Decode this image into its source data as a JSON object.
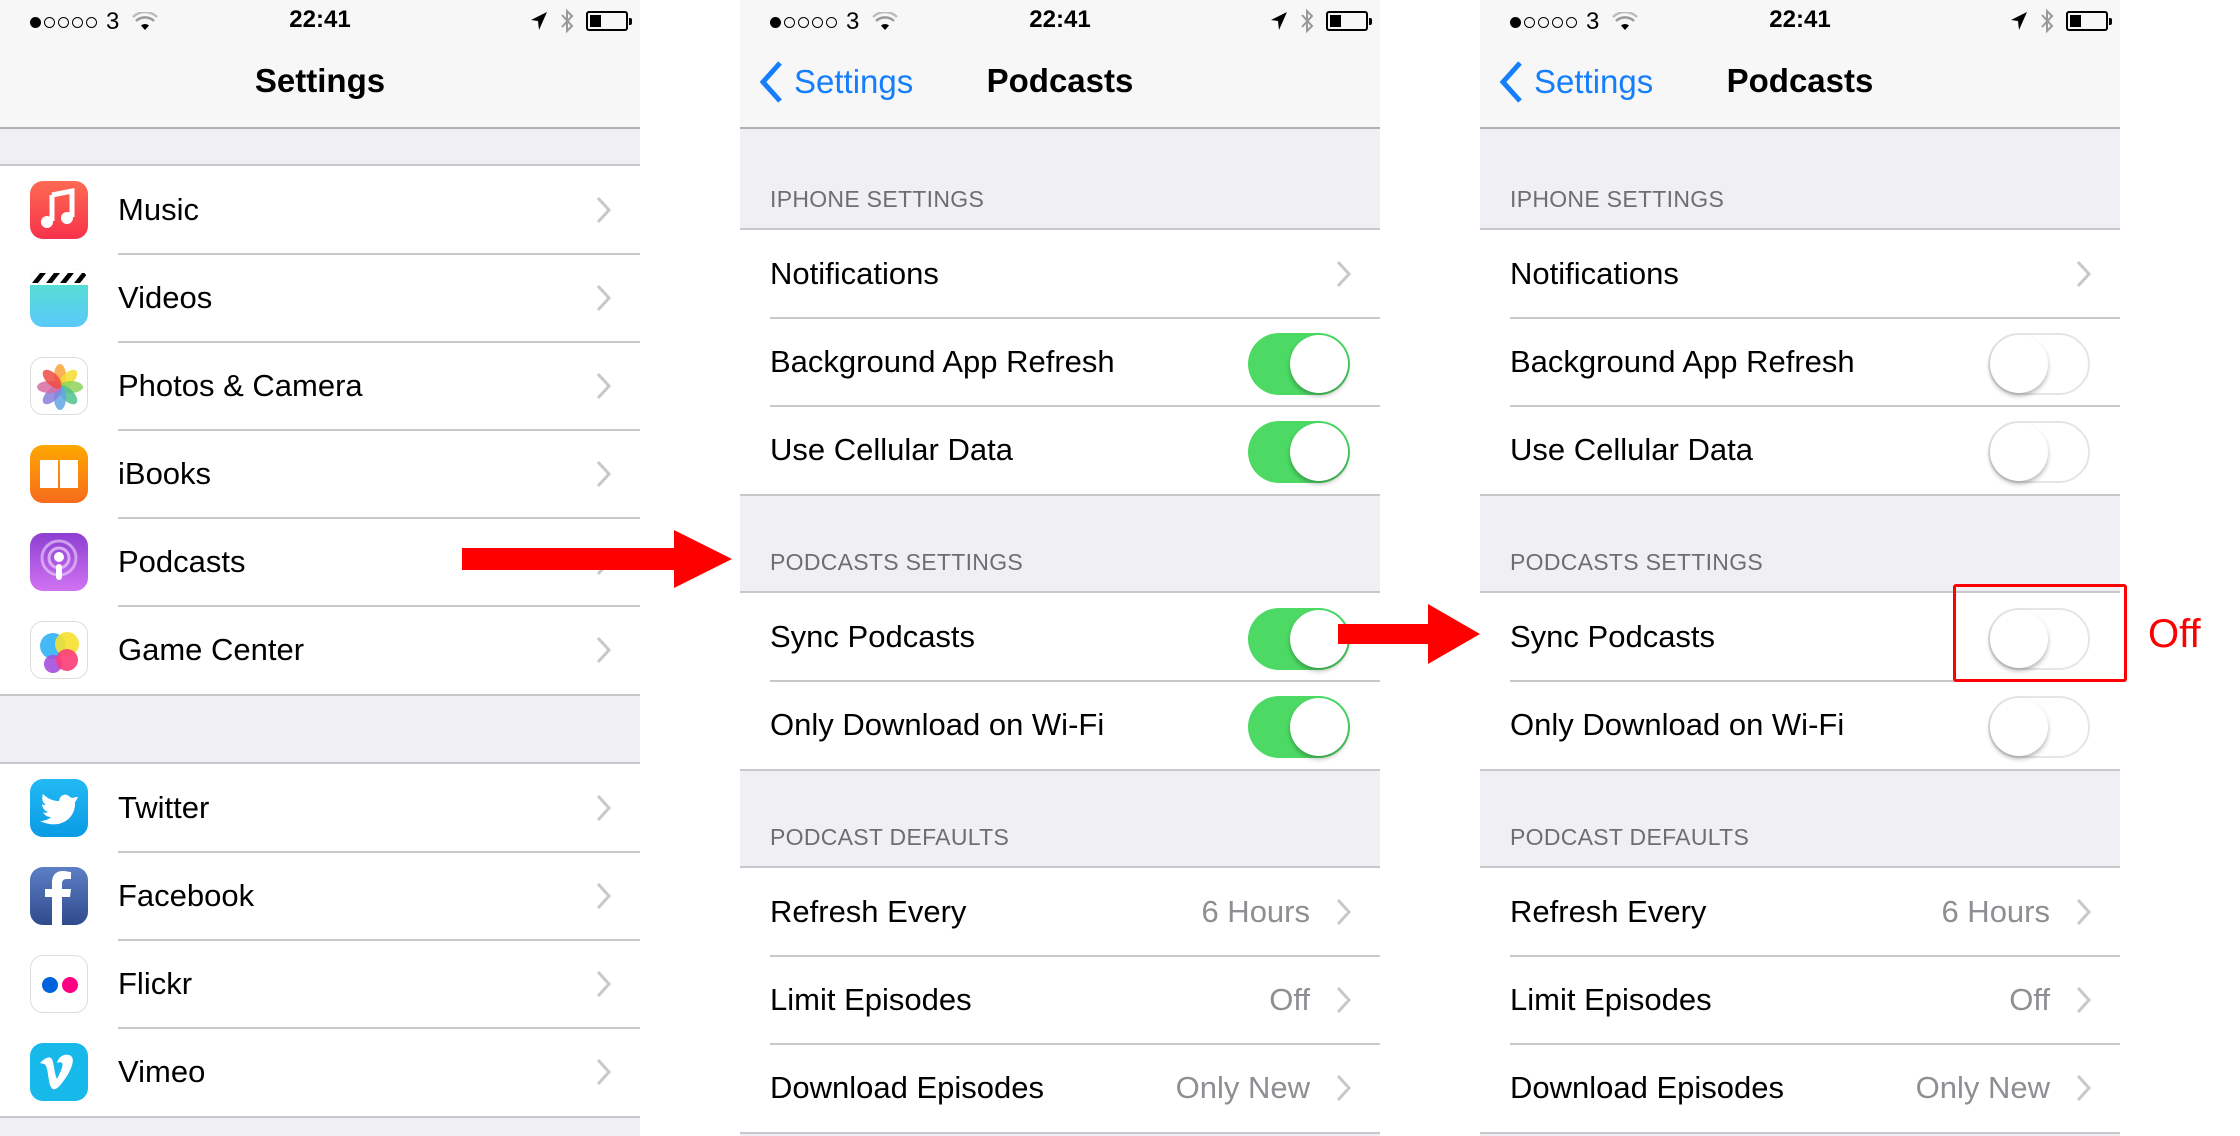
{
  "status_bar": {
    "signal_bars_filled": 1,
    "signal_bars_total": 5,
    "carrier": "3",
    "time": "22:41",
    "battery_level_percent": 30
  },
  "panels": [
    {
      "nav": {
        "title": "Settings"
      },
      "groups": [
        {
          "items": [
            {
              "label": "Music",
              "icon": "music-icon"
            },
            {
              "label": "Videos",
              "icon": "videos-icon"
            },
            {
              "label": "Photos & Camera",
              "icon": "photos-icon"
            },
            {
              "label": "iBooks",
              "icon": "ibooks-icon"
            },
            {
              "label": "Podcasts",
              "icon": "podcasts-icon"
            },
            {
              "label": "Game Center",
              "icon": "game-center-icon"
            }
          ]
        },
        {
          "items": [
            {
              "label": "Twitter",
              "icon": "twitter-icon"
            },
            {
              "label": "Facebook",
              "icon": "facebook-icon"
            },
            {
              "label": "Flickr",
              "icon": "flickr-icon"
            },
            {
              "label": "Vimeo",
              "icon": "vimeo-icon"
            }
          ]
        }
      ]
    },
    {
      "nav": {
        "back_label": "Settings",
        "title": "Podcasts"
      },
      "sections": [
        {
          "header": "IPHONE SETTINGS",
          "items": [
            {
              "label": "Notifications",
              "type": "disclosure"
            },
            {
              "label": "Background App Refresh",
              "type": "switch",
              "on": true
            },
            {
              "label": "Use Cellular Data",
              "type": "switch",
              "on": true
            }
          ]
        },
        {
          "header": "PODCASTS SETTINGS",
          "items": [
            {
              "label": "Sync Podcasts",
              "type": "switch",
              "on": true
            },
            {
              "label": "Only Download on Wi-Fi",
              "type": "switch",
              "on": true
            }
          ]
        },
        {
          "header": "PODCAST DEFAULTS",
          "items": [
            {
              "label": "Refresh Every",
              "type": "value",
              "value": "6 Hours"
            },
            {
              "label": "Limit Episodes",
              "type": "value",
              "value": "Off"
            },
            {
              "label": "Download Episodes",
              "type": "value",
              "value": "Only New"
            }
          ]
        }
      ]
    },
    {
      "nav": {
        "back_label": "Settings",
        "title": "Podcasts"
      },
      "sections": [
        {
          "header": "IPHONE SETTINGS",
          "items": [
            {
              "label": "Notifications",
              "type": "disclosure"
            },
            {
              "label": "Background App Refresh",
              "type": "switch",
              "on": false
            },
            {
              "label": "Use Cellular Data",
              "type": "switch",
              "on": false
            }
          ]
        },
        {
          "header": "PODCASTS SETTINGS",
          "items": [
            {
              "label": "Sync Podcasts",
              "type": "switch",
              "on": false
            },
            {
              "label": "Only Download on Wi-Fi",
              "type": "switch",
              "on": false
            }
          ]
        },
        {
          "header": "PODCAST DEFAULTS",
          "items": [
            {
              "label": "Refresh Every",
              "type": "value",
              "value": "6 Hours"
            },
            {
              "label": "Limit Episodes",
              "type": "value",
              "value": "Off"
            },
            {
              "label": "Download Episodes",
              "type": "value",
              "value": "Only New"
            }
          ]
        }
      ]
    }
  ],
  "annotations": {
    "off_label": "Off",
    "arrow_color": "#ff0000"
  },
  "colors": {
    "accent": "#147efb",
    "switch_on": "#4cd964",
    "annotation": "#ff0000"
  }
}
